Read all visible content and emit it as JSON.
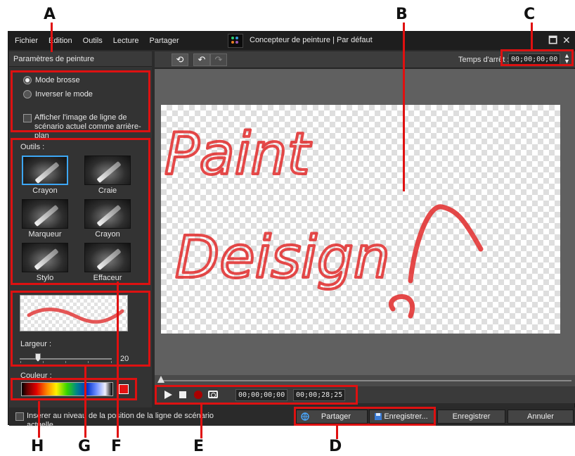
{
  "callouts": {
    "a": "A",
    "b": "B",
    "c": "C",
    "d": "D",
    "e": "E",
    "f": "F",
    "g": "G",
    "h": "H"
  },
  "menu": [
    "Fichier",
    "Édition",
    "Outils",
    "Lecture",
    "Partager"
  ],
  "window_title": "Concepteur de peinture  |  Par défaut",
  "window_controls": {
    "restore": "🗖",
    "close": "✕"
  },
  "left_panel": {
    "header": "Paramètres de peinture",
    "mode_brush": "Mode brosse",
    "mode_invert": "Inverser le mode",
    "background_checkbox": "Afficher l'image de ligne de scénario actuel comme arrière-plan",
    "tools_label": "Outils :",
    "tools": [
      {
        "label": "Crayon",
        "icon": "pencil-icon"
      },
      {
        "label": "Craie",
        "icon": "chalk-icon"
      },
      {
        "label": "Marqueur",
        "icon": "marker-icon"
      },
      {
        "label": "Crayon",
        "icon": "crayon-icon"
      },
      {
        "label": "Stylo",
        "icon": "pen-icon"
      },
      {
        "label": "Effaceur",
        "icon": "eraser-icon"
      }
    ],
    "width_label": "Largeur :",
    "width_value": "20",
    "color_label": "Couleur :"
  },
  "toolbar": {
    "stop_time_label": "Temps d'arrêt :",
    "stop_time_value": "00;00;00;00"
  },
  "canvas": {
    "line1": "Paint",
    "line2": "Deisign"
  },
  "playback": {
    "current_time": "00;00;00;00",
    "duration": "00;00;28;25"
  },
  "bottom": {
    "insert_checkbox": "Insérer au niveau de la position de la ligne de scénario actuelle",
    "share": "Partager",
    "save_as": "Enregistrer...",
    "save": "Enregistrer",
    "cancel": "Annuler"
  },
  "colors": {
    "highlight": "#d11111",
    "selected_tool": "#3da7f5",
    "paint_color": "#e31212"
  }
}
